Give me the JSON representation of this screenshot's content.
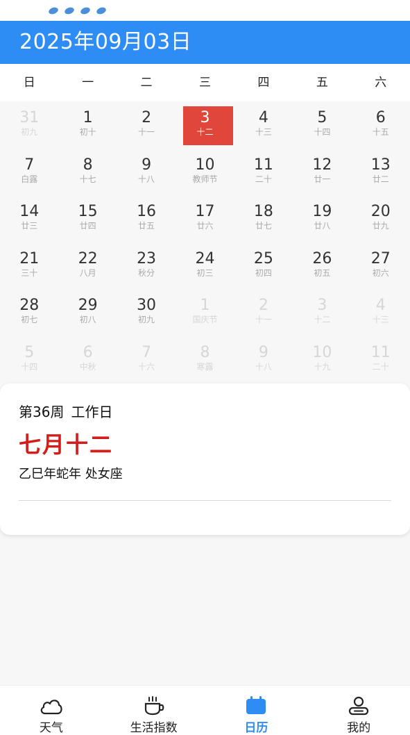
{
  "header": {
    "title": "2025年09月03日"
  },
  "weekdays": [
    "日",
    "一",
    "二",
    "三",
    "四",
    "五",
    "六"
  ],
  "calendar": {
    "cells": [
      {
        "day": "31",
        "lunar": "初九",
        "other": true
      },
      {
        "day": "1",
        "lunar": "初十"
      },
      {
        "day": "2",
        "lunar": "十一"
      },
      {
        "day": "3",
        "lunar": "十二",
        "selected": true
      },
      {
        "day": "4",
        "lunar": "十三"
      },
      {
        "day": "5",
        "lunar": "十四"
      },
      {
        "day": "6",
        "lunar": "十五"
      },
      {
        "day": "7",
        "lunar": "白露"
      },
      {
        "day": "8",
        "lunar": "十七"
      },
      {
        "day": "9",
        "lunar": "十八"
      },
      {
        "day": "10",
        "lunar": "教师节"
      },
      {
        "day": "11",
        "lunar": "二十"
      },
      {
        "day": "12",
        "lunar": "廿一"
      },
      {
        "day": "13",
        "lunar": "廿二"
      },
      {
        "day": "14",
        "lunar": "廿三"
      },
      {
        "day": "15",
        "lunar": "廿四"
      },
      {
        "day": "16",
        "lunar": "廿五"
      },
      {
        "day": "17",
        "lunar": "廿六"
      },
      {
        "day": "18",
        "lunar": "廿七"
      },
      {
        "day": "19",
        "lunar": "廿八"
      },
      {
        "day": "20",
        "lunar": "廿九"
      },
      {
        "day": "21",
        "lunar": "三十"
      },
      {
        "day": "22",
        "lunar": "八月"
      },
      {
        "day": "23",
        "lunar": "秋分"
      },
      {
        "day": "24",
        "lunar": "初三"
      },
      {
        "day": "25",
        "lunar": "初四"
      },
      {
        "day": "26",
        "lunar": "初五"
      },
      {
        "day": "27",
        "lunar": "初六"
      },
      {
        "day": "28",
        "lunar": "初七"
      },
      {
        "day": "29",
        "lunar": "初八"
      },
      {
        "day": "30",
        "lunar": "初九"
      },
      {
        "day": "1",
        "lunar": "国庆节",
        "other": true
      },
      {
        "day": "2",
        "lunar": "十一",
        "other": true
      },
      {
        "day": "3",
        "lunar": "十二",
        "other": true
      },
      {
        "day": "4",
        "lunar": "十三",
        "other": true
      },
      {
        "day": "5",
        "lunar": "十四",
        "other": true
      },
      {
        "day": "6",
        "lunar": "中秋",
        "other": true
      },
      {
        "day": "7",
        "lunar": "十六",
        "other": true
      },
      {
        "day": "8",
        "lunar": "寒露",
        "other": true
      },
      {
        "day": "9",
        "lunar": "十八",
        "other": true
      },
      {
        "day": "10",
        "lunar": "十九",
        "other": true
      },
      {
        "day": "11",
        "lunar": "二十",
        "other": true
      }
    ]
  },
  "info": {
    "week": "第36周",
    "day_type": "工作日",
    "lunar_date": "七月十二",
    "ganzhi": "乙巳年蛇年 处女座"
  },
  "nav": {
    "weather": "天气",
    "life_index": "生活指数",
    "calendar": "日历",
    "mine": "我的"
  },
  "colors": {
    "header_bg": "#2e8cf5",
    "selected_bg": "#e0473a",
    "lunar_red": "#d61b1b",
    "nav_active": "#2e8cf5"
  }
}
